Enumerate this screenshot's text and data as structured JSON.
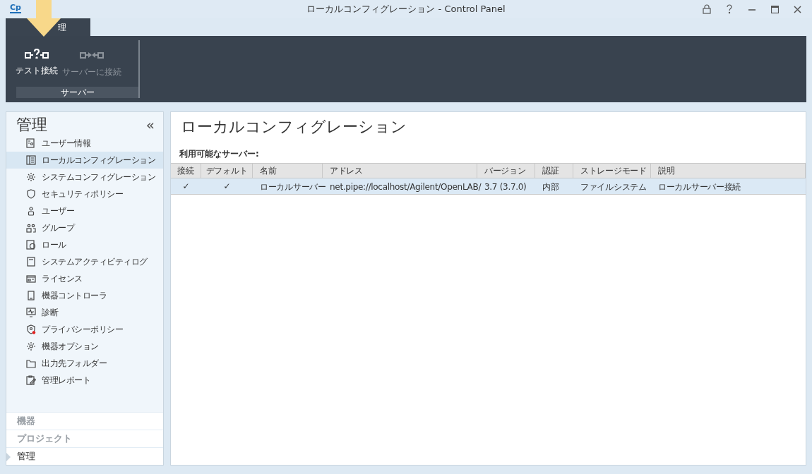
{
  "window": {
    "logo": "Cp",
    "title": "ローカルコンフィグレーション - Control Panel"
  },
  "ribbon": {
    "tabs": [
      {
        "label": "理",
        "selected": true
      }
    ],
    "buttons": [
      {
        "label": "テスト接続",
        "disabled": false
      },
      {
        "label": "サーバーに接続",
        "disabled": true
      }
    ],
    "group_label": "サーバー"
  },
  "sidebar": {
    "title": "管理",
    "collapse": "«",
    "items": [
      {
        "label": "ユーザー情報",
        "selected": false
      },
      {
        "label": "ローカルコンフィグレーション",
        "selected": true
      },
      {
        "label": "システムコンフィグレーション",
        "selected": false
      },
      {
        "label": "セキュリティポリシー",
        "selected": false
      },
      {
        "label": "ユーザー",
        "selected": false
      },
      {
        "label": "グループ",
        "selected": false
      },
      {
        "label": "ロール",
        "selected": false
      },
      {
        "label": "システムアクティビティログ",
        "selected": false
      },
      {
        "label": "ライセンス",
        "selected": false
      },
      {
        "label": "機器コントローラ",
        "selected": false
      },
      {
        "label": "診断",
        "selected": false
      },
      {
        "label": "プライバシーポリシー",
        "selected": false
      },
      {
        "label": "機器オプション",
        "selected": false
      },
      {
        "label": "出力先フォルダー",
        "selected": false
      },
      {
        "label": "管理レポート",
        "selected": false
      }
    ],
    "sections": [
      {
        "label": "機器",
        "selected": false
      },
      {
        "label": "プロジェクト",
        "selected": false
      },
      {
        "label": "管理",
        "selected": true
      }
    ]
  },
  "main": {
    "title": "ローカルコンフィグレーション",
    "subtitle": "利用可能なサーバー:",
    "table": {
      "columns": [
        "接続",
        "デフォルト",
        "名前",
        "アドレス",
        "バージョン",
        "認証",
        "ストレージモード",
        "説明"
      ],
      "rows": [
        {
          "selected": true,
          "cells": [
            "✓",
            "✓",
            "ローカルサーバー",
            "net.pipe://localhost/Agilent/OpenLAB/",
            "3.7 (3.7.0)",
            "内部",
            "ファイルシステム",
            "ローカルサーバー接続"
          ]
        }
      ]
    }
  }
}
